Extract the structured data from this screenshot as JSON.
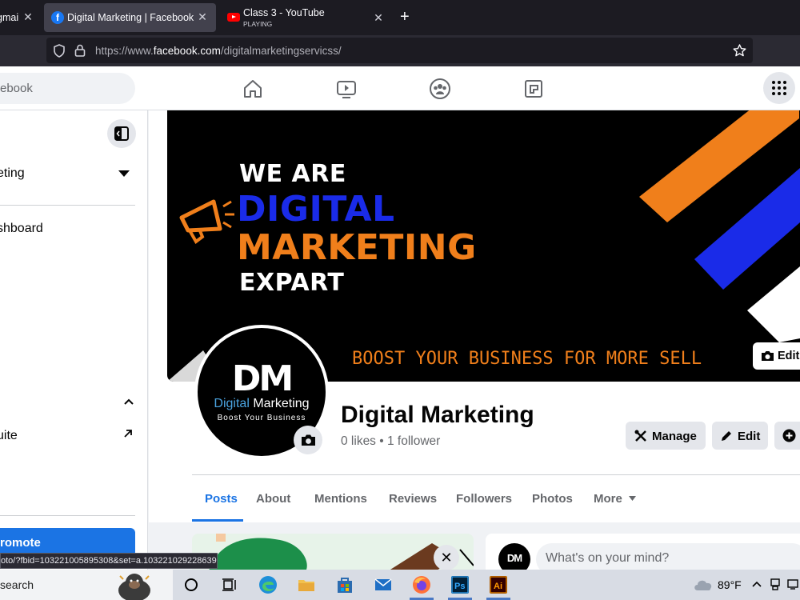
{
  "browser": {
    "tabs": [
      {
        "title": "gmai",
        "subtitle": ""
      },
      {
        "title": "Digital Marketing | Facebook",
        "subtitle": ""
      },
      {
        "title": "Class 3 - YouTube",
        "subtitle": "PLAYING"
      }
    ],
    "url_prefix": "https://www.",
    "url_domain": "facebook.com",
    "url_path": "/digitalmarketingservicss/"
  },
  "fb": {
    "search_placeholder": "ebook",
    "nav_icons": [
      "home-icon",
      "watch-icon",
      "groups-icon",
      "gaming-icon",
      "menu-grid-icon"
    ]
  },
  "sidebar": {
    "page_select": "eting",
    "dashboard": "shboard",
    "suite": "uite",
    "promote": "romote"
  },
  "cover": {
    "line1": "WE ARE",
    "line2": "DIGITAL",
    "line3": "MARKETING",
    "line4": "EXPART",
    "tagline": "BOOST YOUR BUSINESS FOR MORE SELL",
    "edit_label": "Edit",
    "colors": {
      "blue": "#1a2be8",
      "orange": "#f07f1b",
      "white": "#ffffff"
    }
  },
  "logo": {
    "mark": "DM",
    "name_a": "Digital",
    "name_b": "Marketing",
    "slogan": "Boost Your Business"
  },
  "page": {
    "name": "Digital Marketing",
    "stats": "0 likes • 1 follower",
    "buttons": {
      "manage": "Manage",
      "edit": "Edit"
    }
  },
  "tabs": [
    "Posts",
    "About",
    "Mentions",
    "Reviews",
    "Followers",
    "Photos",
    "More"
  ],
  "composer": {
    "placeholder": "What's on your mind?",
    "avatar_text": "DM"
  },
  "status_url": "oto/?fbid=103221005895308&set=a.103221029228639",
  "taskbar": {
    "search": "search",
    "temperature": "89°F"
  },
  "accent": "#1b74e4"
}
